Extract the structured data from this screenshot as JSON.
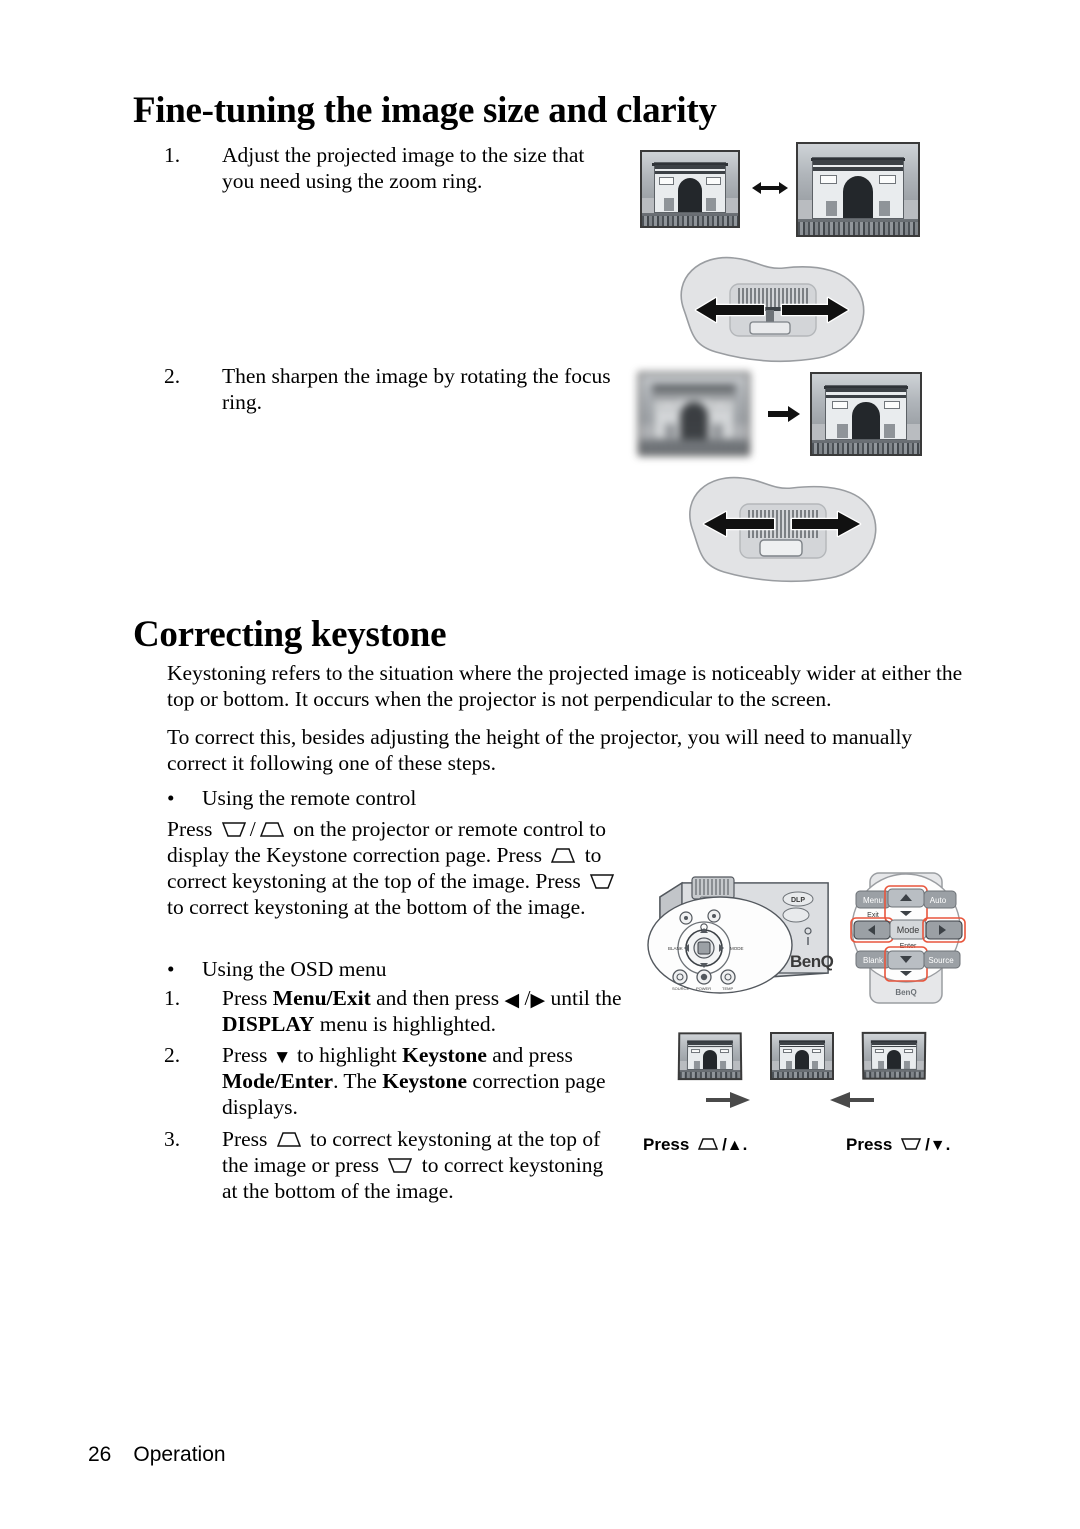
{
  "page": {
    "footer_page_number": "26",
    "footer_section": "Operation"
  },
  "sections": [
    {
      "id": "fine-tuning",
      "heading": "Fine-tuning the image size and clarity",
      "steps": [
        {
          "number": "1.",
          "text": "Adjust the projected image to the size that you need using the zoom ring."
        },
        {
          "number": "2.",
          "text": "Then sharpen the image by rotating the focus ring."
        }
      ]
    },
    {
      "id": "correcting-keystone",
      "heading": "Correcting keystone",
      "paragraphs": [
        "Keystoning refers to the situation where the projected image is noticeably wider at either the top or bottom. It occurs when the projector is not perpendicular to the screen.",
        "To correct this, besides adjusting the height of the projector, you will need to manually correct it following one of these steps."
      ],
      "remote_control": {
        "bullet": "•",
        "label": "Using the remote control",
        "paragraph_parts": {
          "p1": "Press",
          "sep": "/",
          "p2": "on the projector or remote control to display the Keystone correction page. Press",
          "p3": "to correct keystoning at the top of the image. Press",
          "p4": "to correct keystoning at the bottom of the image."
        }
      },
      "osd_menu": {
        "bullet": "•",
        "label": "Using the OSD menu",
        "steps": [
          {
            "number": "1.",
            "parts": {
              "a": "Press ",
              "b_bold": "Menu/Exit",
              "c": " and then press ",
              "left_arrow": "◀",
              "slash": "/",
              "right_arrow": "▶",
              "d": " until the ",
              "e_bold": "DISPLAY",
              "f": " menu is highlighted."
            }
          },
          {
            "number": "2.",
            "parts": {
              "a": "Press ",
              "down_arrow": "▼",
              "b": " to highlight ",
              "c_bold": "Keystone",
              "d": " and press ",
              "e_bold": "Mode/Enter",
              "f": ". The ",
              "g_bold": "Keystone",
              "h": " correction page displays."
            }
          },
          {
            "number": "3.",
            "parts": {
              "a": "Press",
              "b": "to correct keystoning at the top of the image or press",
              "c": "to correct keystoning at the bottom of the image."
            }
          }
        ]
      }
    }
  ],
  "figures": {
    "zoom_ring": {
      "name": "zoom-ring-illustration",
      "arrow": "↔",
      "caption": ""
    },
    "focus_ring": {
      "name": "focus-ring-illustration",
      "arrow": "→",
      "caption": ""
    },
    "projector_remote": {
      "projector_brand": "BenQ",
      "projector_badge_dlp": "DLP",
      "remote_brand": "BenQ",
      "remote_buttons": [
        "Menu",
        "Exit",
        "Auto",
        "Mode",
        "Enter",
        "Blank",
        "Source"
      ]
    },
    "keystone_samples": {
      "press_up_caption": "Press",
      "press_up_slash": "/",
      "press_up_triangle": "▲",
      "press_up_period": ".",
      "press_down_caption": "Press",
      "press_down_slash": "/",
      "press_down_triangle": "▼",
      "press_down_period": "."
    }
  },
  "icons": {
    "keystone_up": "keystone-up-trapezoid-icon",
    "keystone_down": "keystone-down-trapezoid-icon",
    "arrow_left": "arrow-left-icon",
    "arrow_right": "arrow-right-icon",
    "arrow_up": "arrow-up-icon",
    "arrow_down": "arrow-down-icon"
  },
  "colors": {
    "text": "#000000",
    "device_gray": "#c9ccd0",
    "device_outline": "#5b6066",
    "highlight_red": "#e8553c",
    "button_gray": "#8b9096"
  }
}
